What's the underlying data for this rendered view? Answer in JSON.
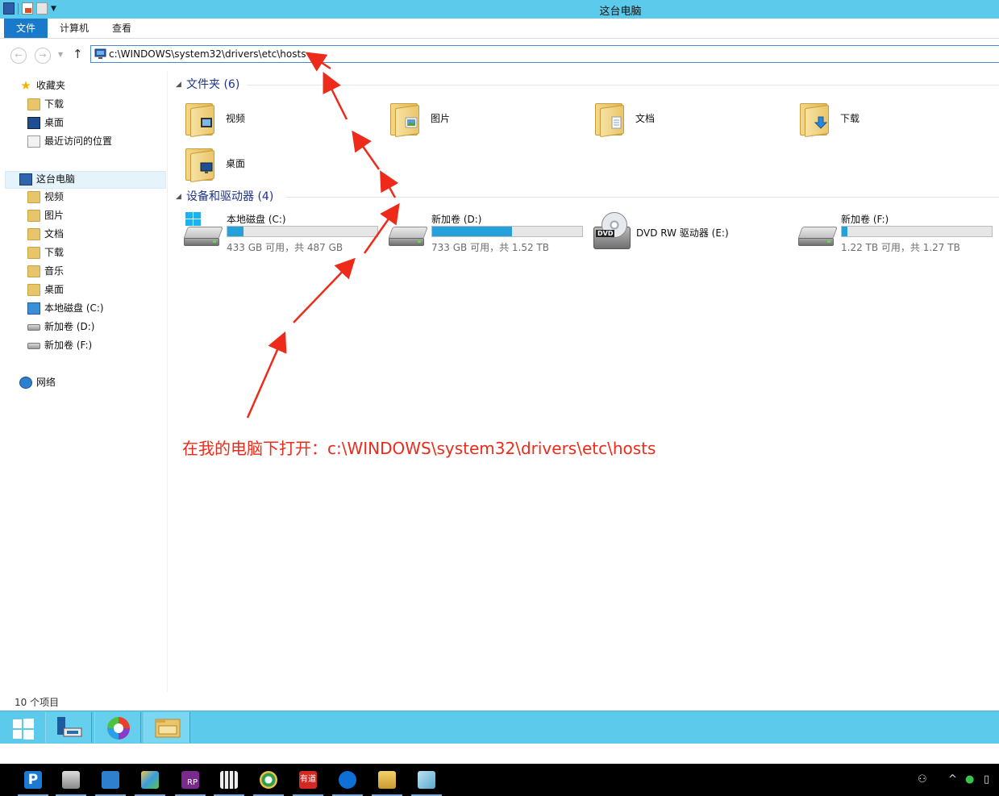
{
  "window": {
    "title": "这台电脑"
  },
  "ribbon": {
    "tabs": [
      "文件",
      "计算机",
      "查看"
    ]
  },
  "address_bar": {
    "path": "c:\\WINDOWS\\system32\\drivers\\etc\\hosts"
  },
  "sidebar": {
    "favorites_label": "收藏夹",
    "favorites": [
      "下载",
      "桌面",
      "最近访问的位置"
    ],
    "this_pc_label": "这台电脑",
    "this_pc_items": [
      "视频",
      "图片",
      "文档",
      "下载",
      "音乐",
      "桌面",
      "本地磁盘 (C:)",
      "新加卷 (D:)",
      "新加卷 (F:)"
    ],
    "network_label": "网络"
  },
  "folders_group": {
    "title": "文件夹 (6)",
    "items": [
      "视频",
      "图片",
      "文档",
      "下载",
      "桌面"
    ]
  },
  "drives_group": {
    "title": "设备和驱动器 (4)",
    "drives": [
      {
        "name": "本地磁盘 (C:)",
        "space": "433 GB 可用，共 487 GB",
        "used_fraction": 0.11
      },
      {
        "name": "新加卷 (D:)",
        "space": "733 GB 可用，共 1.52 TB",
        "used_fraction": 0.53
      },
      {
        "name": "新加卷 (F:)",
        "space": "1.22 TB 可用，共 1.27 TB",
        "used_fraction": 0.04
      }
    ],
    "dvd": {
      "name": "DVD RW 驱动器 (E:)",
      "badge": "DVD"
    }
  },
  "status_bar": {
    "item_count": "10 个项目"
  },
  "annotation": {
    "text": "在我的电脑下打开：c:\\WINDOWS\\system32\\drivers\\etc\\hosts",
    "color": "#ee2b1a"
  },
  "colors": {
    "titlebar": "#5ccaeb",
    "file_tab": "#1979ca",
    "group_header": "#1e3287",
    "drive_bar_fill": "#26a0da"
  },
  "host_taskbar": {
    "apps": [
      "p-icon",
      "disk-cleanup-icon",
      "computer-icon",
      "network-icon",
      "axure-rp-icon",
      "calculator-icon",
      "browser-icon",
      "youdao-icon",
      "teamviewer-icon",
      "tools-icon",
      "notepad-icon"
    ],
    "rp_label": "RP",
    "youdao_label": "有道"
  }
}
